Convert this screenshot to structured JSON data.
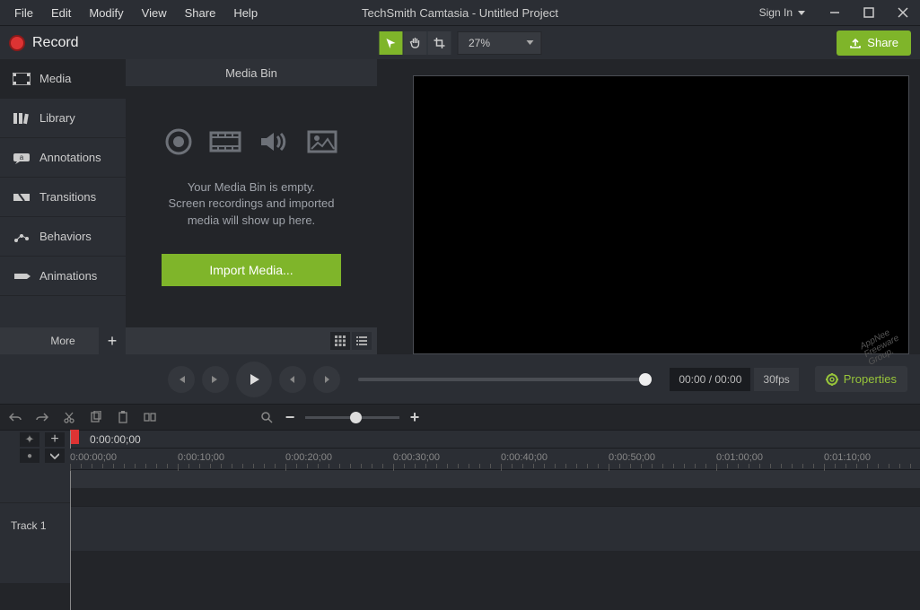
{
  "titlebar": {
    "menus": [
      "File",
      "Edit",
      "Modify",
      "View",
      "Share",
      "Help"
    ],
    "title": "TechSmith Camtasia - Untitled Project",
    "signin": "Sign In"
  },
  "toolbar": {
    "record": "Record",
    "zoom": "27%",
    "share": "Share"
  },
  "sidebar": {
    "items": [
      {
        "label": "Media",
        "icon": "media-icon"
      },
      {
        "label": "Library",
        "icon": "library-icon"
      },
      {
        "label": "Annotations",
        "icon": "annotations-icon"
      },
      {
        "label": "Transitions",
        "icon": "transitions-icon"
      },
      {
        "label": "Behaviors",
        "icon": "behaviors-icon"
      },
      {
        "label": "Animations",
        "icon": "animations-icon"
      }
    ],
    "more": "More"
  },
  "mediabin": {
    "title": "Media Bin",
    "empty1": "Your Media Bin is empty.",
    "empty2": "Screen recordings and imported",
    "empty3": "media will show up here.",
    "import": "Import Media..."
  },
  "playback": {
    "time": "00:00 / 00:00",
    "fps": "30fps",
    "properties": "Properties"
  },
  "timeline": {
    "playhead": "0:00:00;00",
    "track1": "Track 1",
    "ticks": [
      "0:00:00;00",
      "0:00:10;00",
      "0:00:20;00",
      "0:00:30;00",
      "0:00:40;00",
      "0:00:50;00",
      "0:01:00;00",
      "0:01:10;00"
    ]
  },
  "watermark": {
    "l1": "AppNee",
    "l2": "Freeware",
    "l3": "Group."
  }
}
